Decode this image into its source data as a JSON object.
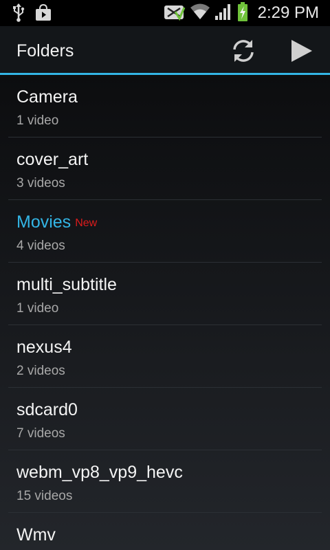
{
  "status_bar": {
    "time": "2:29 PM",
    "icons": [
      "usb-icon",
      "shopping-bag-icon",
      "no-sim-icon",
      "wifi-icon",
      "signal-icon",
      "battery-charging-icon"
    ]
  },
  "action_bar": {
    "title": "Folders",
    "accent": "#33b5e5",
    "actions": [
      "refresh-icon",
      "play-icon"
    ]
  },
  "folders": [
    {
      "name": "Camera",
      "count": "1 video"
    },
    {
      "name": "cover_art",
      "count": "3 videos"
    },
    {
      "name": "Movies",
      "badge": "New",
      "count": "4 videos",
      "highlight": true
    },
    {
      "name": "multi_subtitle",
      "count": "1 video"
    },
    {
      "name": "nexus4",
      "count": "2 videos"
    },
    {
      "name": "sdcard0",
      "count": "7 videos"
    },
    {
      "name": "webm_vp8_vp9_hevc",
      "count": "15 videos"
    },
    {
      "name": "Wmv",
      "count": ""
    }
  ],
  "colors": {
    "highlight": "#33b5e5",
    "badge": "#dd1c1c"
  }
}
